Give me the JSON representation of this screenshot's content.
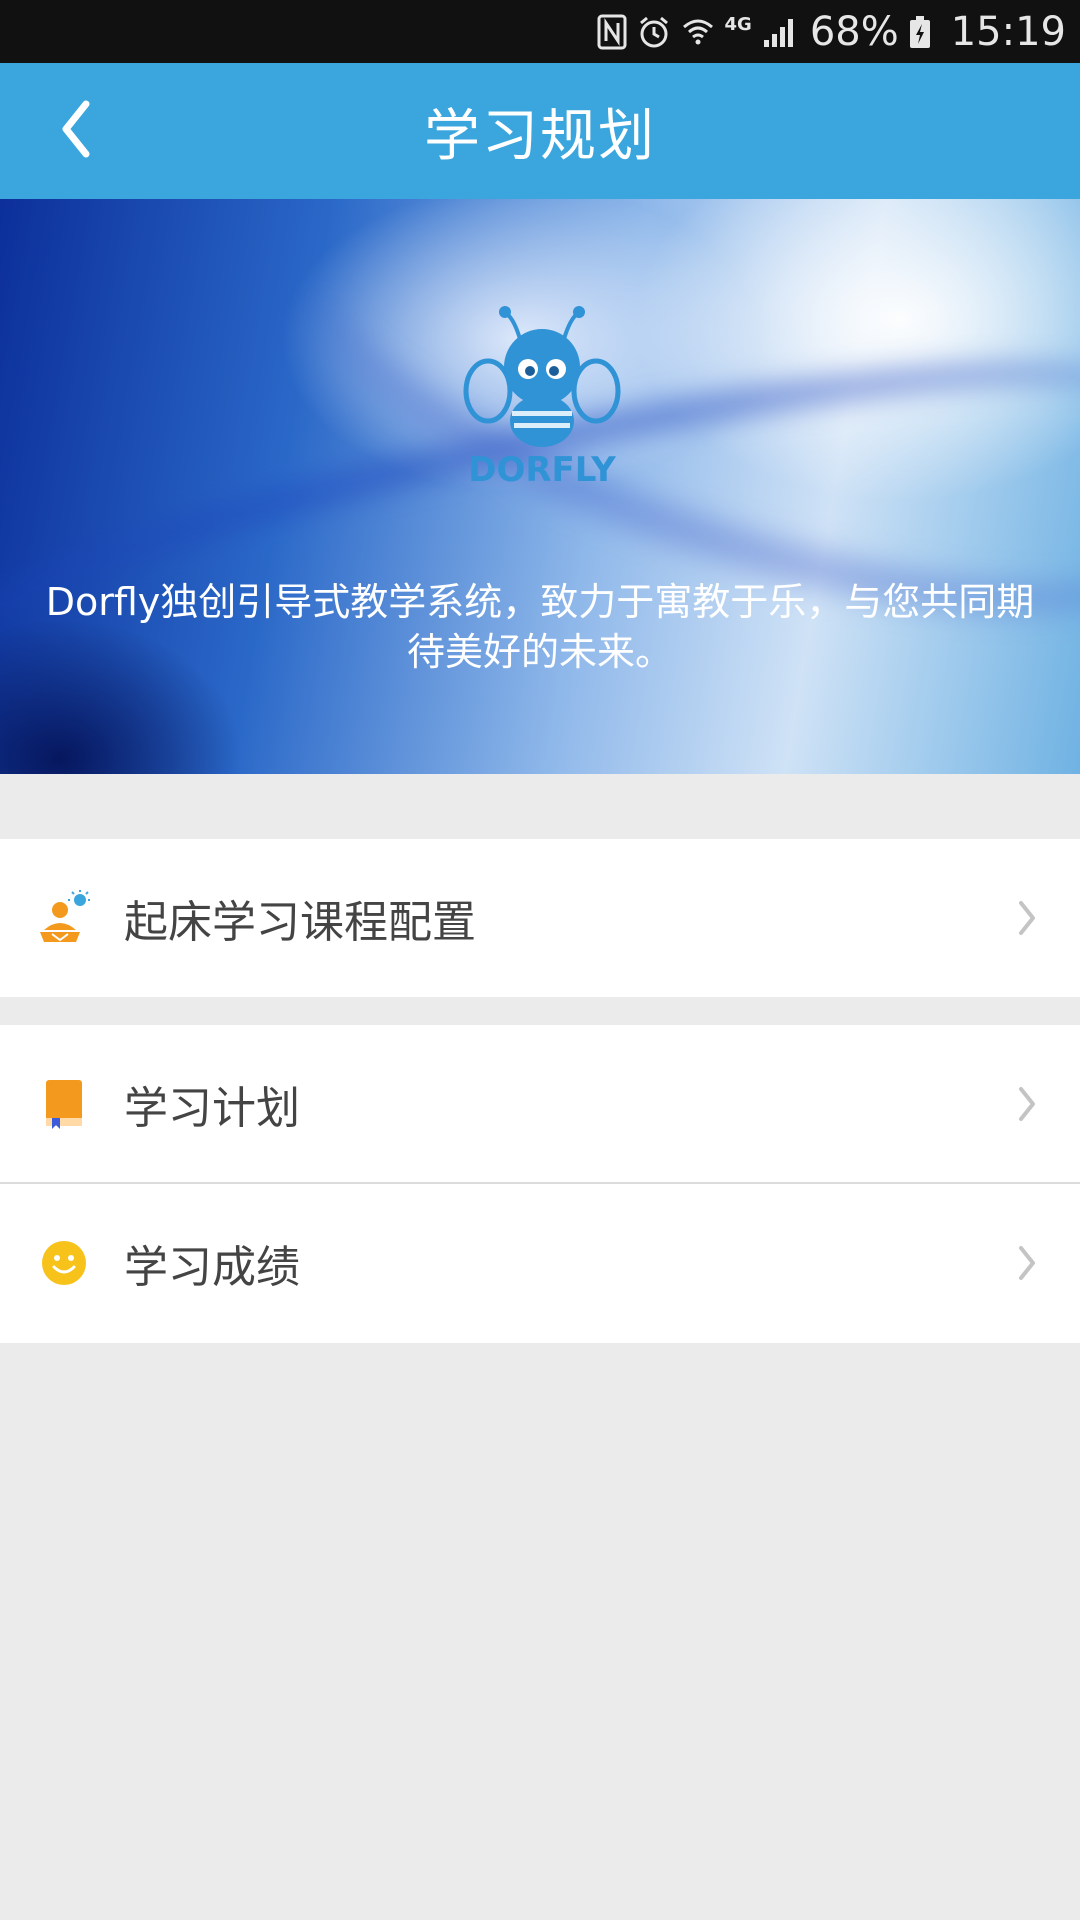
{
  "status_bar": {
    "icons": [
      "nfc-icon",
      "alarm-icon",
      "wifi-icon",
      "4g-icon",
      "signal-icon",
      "battery-icon"
    ],
    "network_type": "4G",
    "battery_percent": "68%",
    "time": "15:19"
  },
  "header": {
    "title": "学习规划",
    "back_icon": "chevron-left-icon"
  },
  "banner": {
    "logo_text": "DORFLY",
    "description": "Dorfly独创引导式教学系统，致力于寓教于乐，与您共同期待美好的未来。"
  },
  "menu_groups": [
    {
      "items": [
        {
          "label": "起床学习课程配置",
          "icon": "morning-study-icon"
        }
      ]
    },
    {
      "items": [
        {
          "label": "学习计划",
          "icon": "book-icon"
        },
        {
          "label": "学习成绩",
          "icon": "smiley-icon"
        }
      ]
    }
  ],
  "colors": {
    "primary": "#3ba6dd",
    "background": "#ebebeb",
    "text": "#444444",
    "orange": "#f39a1e",
    "yellow": "#f7c21a"
  }
}
